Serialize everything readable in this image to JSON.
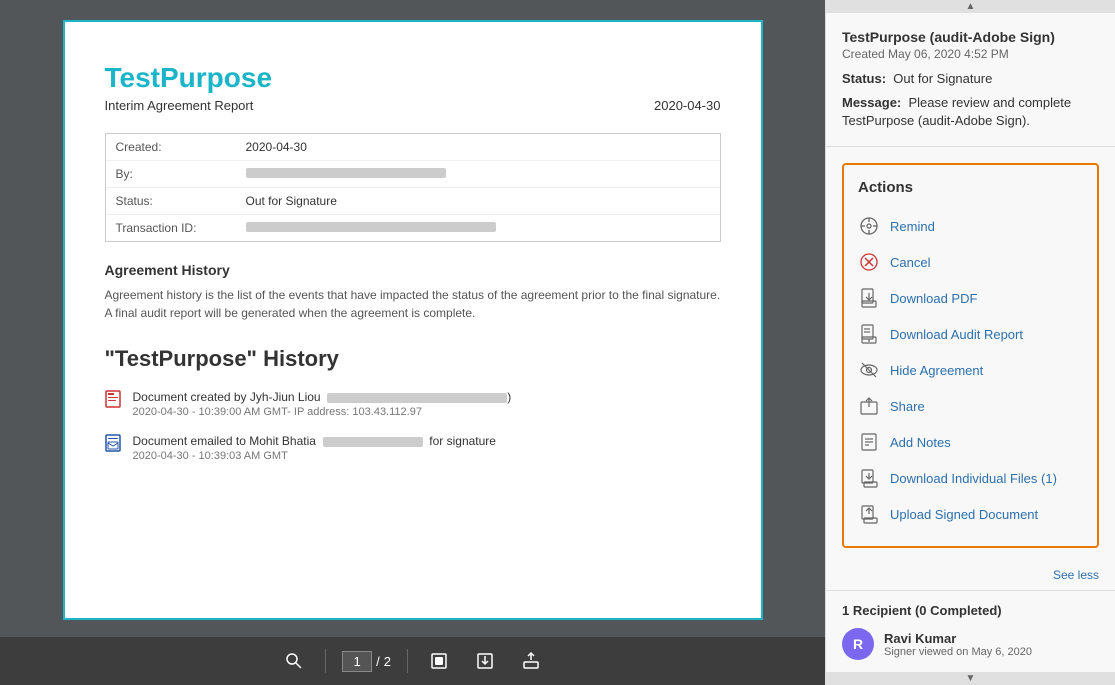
{
  "document": {
    "title": "TestPurpose",
    "subtitle": "Interim Agreement Report",
    "date": "2020-04-30",
    "created_label": "Created:",
    "created_value": "2020-04-30",
    "by_label": "By:",
    "status_label": "Status:",
    "status_value": "Out for Signature",
    "transaction_label": "Transaction ID:",
    "section_title": "Agreement History",
    "section_text": "Agreement history is the list of the events that have impacted the status of the agreement prior to the final signature. A final audit report will be generated when the agreement is complete.",
    "history_title": "\"TestPurpose\" History",
    "history_items": [
      {
        "text": "Document created by Jyh-Jiun Liou",
        "date": "2020-04-30 - 10:39:00 AM GMT- IP address: 103.43.112.97",
        "icon": "document-created"
      },
      {
        "text": "Document emailed to Mohit Bhatia                           for signature",
        "date": "2020-04-30 - 10:39:03 AM GMT",
        "icon": "document-emailed"
      }
    ]
  },
  "toolbar": {
    "search_label": "🔍",
    "page_current": "1",
    "page_separator": "/",
    "page_total": "2",
    "download_icon": "⬇",
    "upload_icon": "⬆",
    "fit_icon": "⊞"
  },
  "right_panel": {
    "agreement_name": "TestPurpose (audit-Adobe Sign)",
    "created_date": "Created May 06, 2020 4:52 PM",
    "status_label": "Status:",
    "status_value": "Out for Signature",
    "message_label": "Message:",
    "message_value": "Please review and complete TestPurpose (audit-Adobe Sign).",
    "actions_title": "Actions",
    "actions": [
      {
        "label": "Remind",
        "icon": "remind"
      },
      {
        "label": "Cancel",
        "icon": "cancel"
      },
      {
        "label": "Download PDF",
        "icon": "download-pdf"
      },
      {
        "label": "Download Audit Report",
        "icon": "download-audit"
      },
      {
        "label": "Hide Agreement",
        "icon": "hide"
      },
      {
        "label": "Share",
        "icon": "share"
      },
      {
        "label": "Add Notes",
        "icon": "notes"
      },
      {
        "label": "Download Individual Files (1)",
        "icon": "download-files"
      },
      {
        "label": "Upload Signed Document",
        "icon": "upload-signed"
      }
    ],
    "see_less": "See less",
    "recipients_title": "1 Recipient (0 Completed)",
    "recipient_name": "Ravi Kumar",
    "recipient_status": "Signer viewed on May 6, 2020",
    "recipient_initials": "R"
  }
}
